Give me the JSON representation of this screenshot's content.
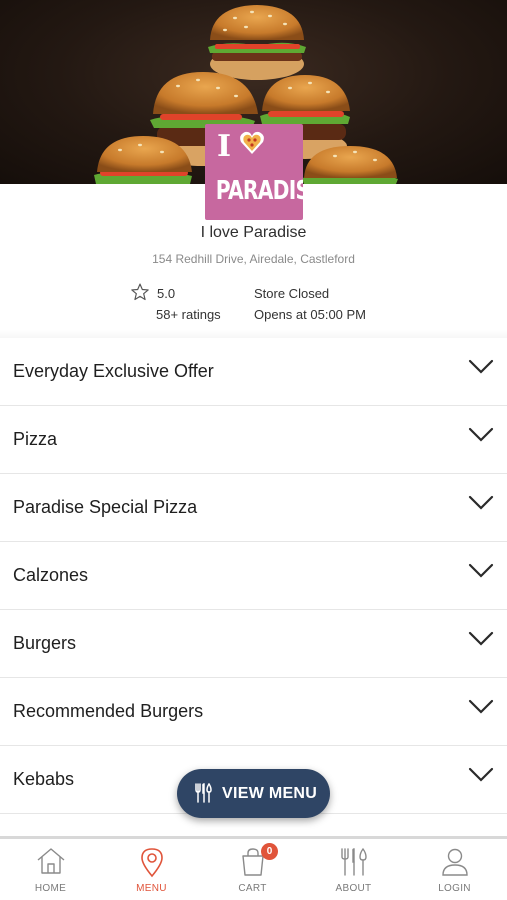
{
  "store": {
    "name": "I love Paradise",
    "address": "154 Redhill Drive, Airedale, Castleford",
    "rating": "5.0",
    "ratings_count": "58+ ratings",
    "status": "Store Closed",
    "opens_at": "Opens at 05:00 PM"
  },
  "logo": {
    "i_letter": "I",
    "word": "PARADISE"
  },
  "categories": [
    {
      "label": "Everyday Exclusive Offer"
    },
    {
      "label": "Pizza"
    },
    {
      "label": "Paradise Special Pizza"
    },
    {
      "label": "Calzones"
    },
    {
      "label": "Burgers"
    },
    {
      "label": "Recommended Burgers"
    },
    {
      "label": "Kebabs"
    }
  ],
  "view_menu_button": {
    "label": "VIEW MENU"
  },
  "bottom_nav": {
    "home": "HOME",
    "menu": "MENU",
    "cart": "CART",
    "cart_count": "0",
    "about": "ABOUT",
    "login": "LOGIN",
    "active": "menu"
  },
  "colors": {
    "accent": "#e0543a",
    "button_bg": "#2f4565",
    "logo_bg": "#c7689f"
  }
}
